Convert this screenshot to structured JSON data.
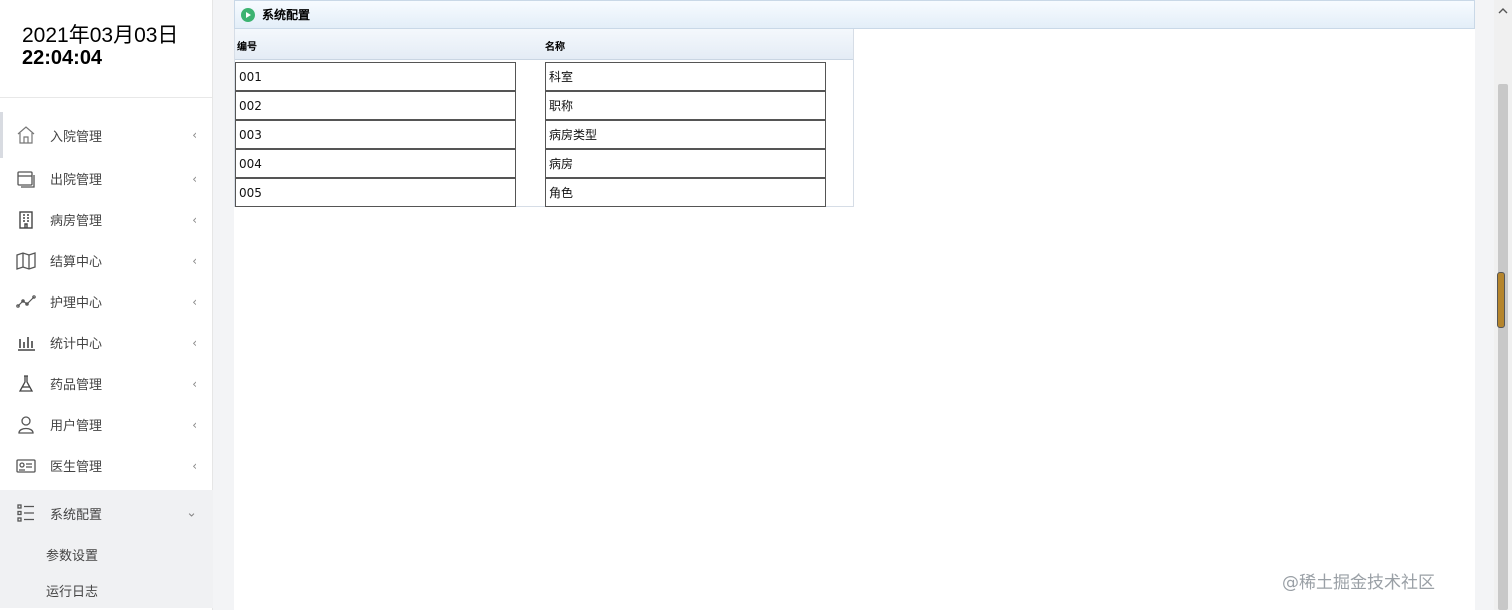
{
  "clock": {
    "date": "2021年03月03日",
    "time": "22:04:04"
  },
  "menu": [
    {
      "label": "入院管理",
      "icon": "home-icon"
    },
    {
      "label": "出院管理",
      "icon": "window-icon"
    },
    {
      "label": "病房管理",
      "icon": "building-icon"
    },
    {
      "label": "结算中心",
      "icon": "map-icon"
    },
    {
      "label": "护理中心",
      "icon": "trend-icon"
    },
    {
      "label": "统计中心",
      "icon": "bar-chart-icon"
    },
    {
      "label": "药品管理",
      "icon": "flask-icon"
    },
    {
      "label": "用户管理",
      "icon": "user-icon"
    },
    {
      "label": "医生管理",
      "icon": "id-card-icon"
    },
    {
      "label": "系统配置",
      "icon": "list-icon"
    }
  ],
  "submenu": [
    "参数设置",
    "运行日志"
  ],
  "chevron_collapsed": "‹",
  "chevron_open": "⌄",
  "panel": {
    "title": "系统配置"
  },
  "table": {
    "columns": [
      "编号",
      "名称"
    ],
    "rows": [
      {
        "id": "001",
        "name": "科室"
      },
      {
        "id": "002",
        "name": "职称"
      },
      {
        "id": "003",
        "name": "病房类型"
      },
      {
        "id": "004",
        "name": "病房"
      },
      {
        "id": "005",
        "name": "角色"
      }
    ]
  },
  "watermark": "@稀土掘金技术社区",
  "colors": {
    "accent_green": "#3cb371",
    "header_bg": "#e3eef8",
    "scroll_thumb": "#b5852d"
  }
}
